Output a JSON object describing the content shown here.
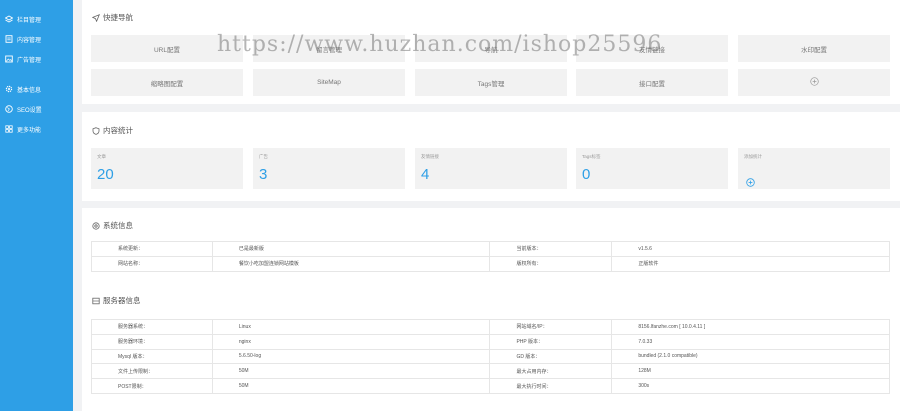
{
  "sidebar": {
    "items": [
      {
        "label": "栏目管理",
        "icon": "stack-icon"
      },
      {
        "label": "内容管理",
        "icon": "document-icon"
      },
      {
        "label": "广告管理",
        "icon": "image-icon"
      },
      {
        "label": "基本信息",
        "icon": "gear-icon"
      },
      {
        "label": "SEO设置",
        "icon": "globe-icon"
      },
      {
        "label": "更多功能",
        "icon": "grid-icon"
      }
    ]
  },
  "quick_nav": {
    "title": "快捷导航",
    "buttons": [
      {
        "label": "URL配置"
      },
      {
        "label": "留言管理"
      },
      {
        "label": "导航"
      },
      {
        "label": "友情链接"
      },
      {
        "label": "水印配置"
      },
      {
        "label": "缩略图配置"
      },
      {
        "label": "SiteMap"
      },
      {
        "label": "Tags管理"
      },
      {
        "label": "接口配置"
      },
      {
        "label": ""
      }
    ]
  },
  "content_stats": {
    "title": "内容统计",
    "cards": [
      {
        "label": "文章",
        "value": "20"
      },
      {
        "label": "广告",
        "value": "3"
      },
      {
        "label": "友情链接",
        "value": "4"
      },
      {
        "label": "Tags标签",
        "value": "0"
      },
      {
        "label": "添加统计",
        "value": ""
      }
    ]
  },
  "system_info": {
    "title": "系统信息",
    "rows": [
      [
        "系统更新：",
        "已是最新版",
        "当前版本：",
        "v1.5.6"
      ],
      [
        "网站名称：",
        "餐饮小吃加盟连锁网站模板",
        "版权所有：",
        "正版软件"
      ]
    ]
  },
  "server_info": {
    "title": "服务器信息",
    "rows": [
      [
        "服务器系统：",
        "Linux",
        "网站域名/IP：",
        "8156.lfanzhe.com [ 10.0.4.11 ]"
      ],
      [
        "服务器环境：",
        "nginx",
        "PHP 版本：",
        "7.0.33"
      ],
      [
        "Mysql 版本：",
        "5.6.50-log",
        "GD 版本：",
        "bundled (2.1.0 compatible)"
      ],
      [
        "文件上传限制：",
        "50M",
        "最大占用内存：",
        "128M"
      ],
      [
        "POST限制：",
        "50M",
        "最大执行时间：",
        "300s"
      ]
    ]
  },
  "watermark": "https://www.huzhan.com/ishop25596",
  "colors": {
    "accent": "#2e9fe6",
    "sidebar_bg": "#2e9fe6",
    "page_bg": "#f1f2f4"
  }
}
